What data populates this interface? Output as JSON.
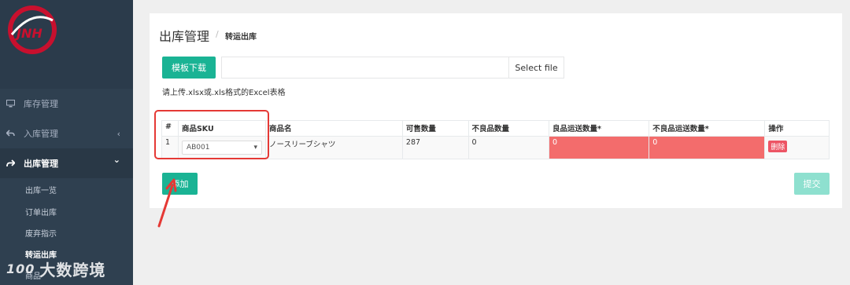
{
  "sidebar": {
    "items": [
      {
        "label": "库存管理",
        "icon": "monitor-icon"
      },
      {
        "label": "入库管理",
        "icon": "reply-arrow-icon",
        "chevron": "‹"
      },
      {
        "label": "出库管理",
        "icon": "share-arrow-icon",
        "chevron": "⌄"
      }
    ],
    "sub_items": [
      "出库一览",
      "订单出库",
      "废弃指示",
      "转运出库"
    ],
    "partial_item": "商品",
    "watermark": "大数跨境",
    "watermark_logo": "100"
  },
  "header": {
    "title": "出库管理",
    "separator": "/",
    "breadcrumb": "转运出库"
  },
  "upload": {
    "template_button": "模板下载",
    "file_value": "",
    "select_file_label": "Select file",
    "hint": "请上传.xlsx或.xls格式的Excel表格"
  },
  "table": {
    "headers": [
      "#",
      "商品SKU",
      "商品名",
      "可售数量",
      "不良品数量",
      "良品运送数量*",
      "不良品运送数量*",
      "操作"
    ],
    "rows": [
      {
        "index": "1",
        "sku": "AB001",
        "name": "ノースリーブシャツ",
        "available": "287",
        "defective": "0",
        "good_ship": "0",
        "bad_ship": "0",
        "action": "删除"
      }
    ]
  },
  "actions": {
    "add_label": "添加",
    "submit_label": "提交"
  },
  "colors": {
    "sidebar_bg": "#2f4050",
    "accent_green": "#1ab394",
    "error_red": "#f36c6c",
    "annotation_red": "#e53935"
  }
}
